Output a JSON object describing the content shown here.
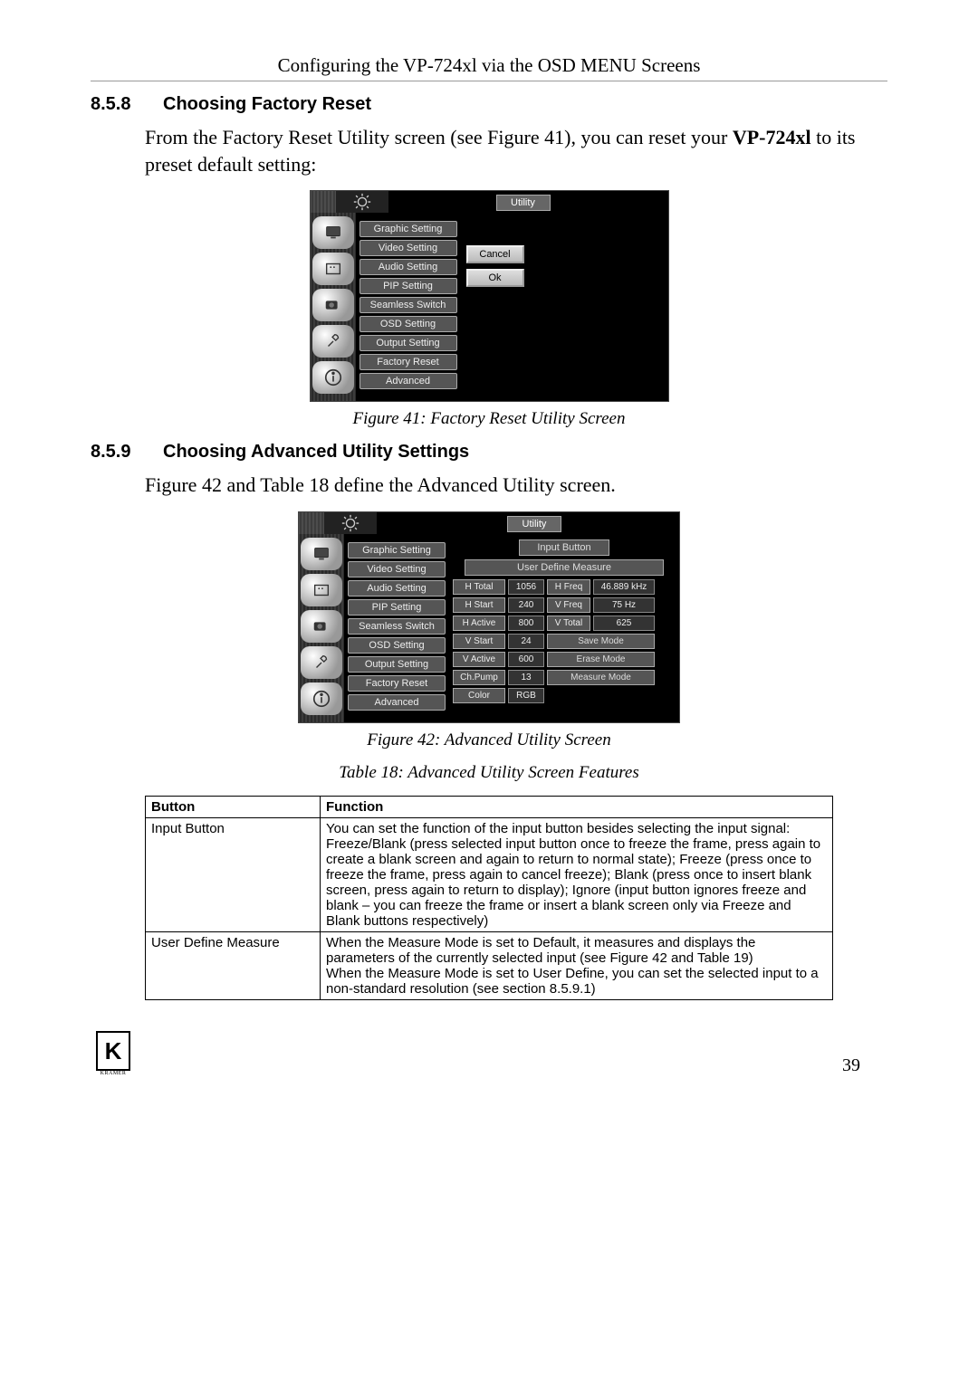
{
  "header": "Configuring the VP-724xl via the OSD MENU Screens",
  "sections": {
    "s858": {
      "num": "8.5.8",
      "title": "Choosing Factory Reset"
    },
    "s859": {
      "num": "8.5.9",
      "title": "Choosing Advanced Utility Settings"
    }
  },
  "paragraphs": {
    "p1a": "From the Factory Reset Utility screen (see Figure 41), you can reset your ",
    "p1b": "VP-724xl",
    "p1c": " to its preset default setting:",
    "p2": "Figure 42 and Table 18 define the Advanced Utility screen."
  },
  "captions": {
    "fig41": "Figure 41: Factory Reset Utility Screen",
    "fig42": "Figure 42: Advanced Utility Screen",
    "tab18": "Table 18: Advanced Utility Screen Features"
  },
  "osd": {
    "title": "Utility",
    "menu": [
      "Graphic Setting",
      "Video Setting",
      "Audio Setting",
      "PIP Setting",
      "Seamless Switch",
      "OSD Setting",
      "Output Setting",
      "Factory Reset",
      "Advanced"
    ],
    "cancel": "Cancel",
    "ok": "Ok",
    "input_button": "Input Button",
    "udm": "User Define Measure",
    "rows": {
      "htotal_l": "H Total",
      "htotal_v": "1056",
      "hfreq_l": "H Freq",
      "hfreq_v": "46.889 kHz",
      "hstart_l": "H Start",
      "hstart_v": "240",
      "vfreq_l": "V Freq",
      "vfreq_v": "75 Hz",
      "hactive_l": "H Active",
      "hactive_v": "800",
      "vtotal_l": "V Total",
      "vtotal_v": "625",
      "vstart_l": "V Start",
      "vstart_v": "24",
      "save": "Save Mode",
      "vactive_l": "V Active",
      "vactive_v": "600",
      "erase": "Erase Mode",
      "chpump_l": "Ch.Pump",
      "chpump_v": "13",
      "measure": "Measure Mode",
      "color_l": "Color",
      "color_v": "RGB"
    }
  },
  "table": {
    "col1": "Button",
    "col2": "Function",
    "rows": [
      {
        "button": "Input Button",
        "function": "You can set the function of the input button besides selecting the input signal: Freeze/Blank (press selected input button once to freeze the frame, press again to create a blank screen and again to return to normal state); Freeze (press once to freeze the frame, press again to cancel freeze); Blank (press once to insert blank screen, press again to return to display); Ignore (input button ignores freeze and blank – you can freeze the frame or insert a blank screen only via Freeze and Blank buttons respectively)"
      },
      {
        "button": "User Define Measure",
        "function": "When the Measure Mode is set to Default, it measures and displays the parameters of the currently selected input (see Figure 42 and Table 19)\nWhen the Measure Mode is set to User Define, you can set the selected input to a non-standard resolution (see section 8.5.9.1)"
      }
    ]
  },
  "page_number": "39",
  "logo_text": "K",
  "logo_sub": "KRAMER"
}
